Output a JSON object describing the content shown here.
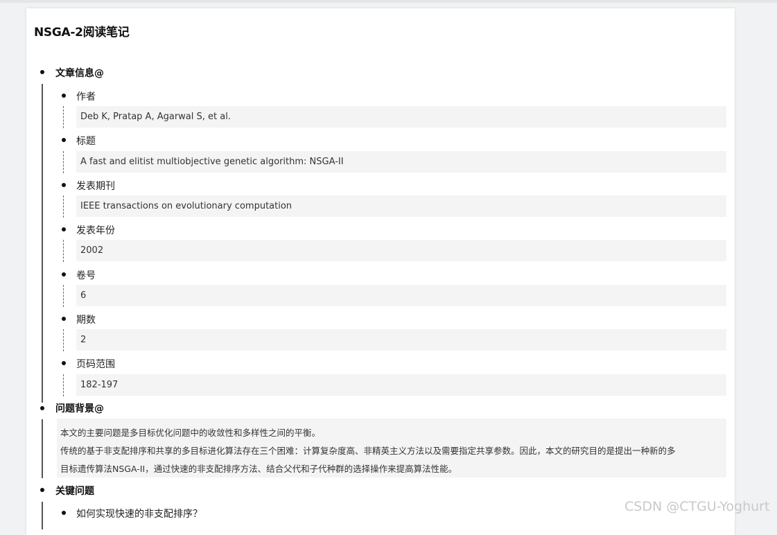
{
  "document": {
    "title": "NSGA-2阅读笔记",
    "sections": {
      "article_info": {
        "heading": "文章信息@",
        "fields": [
          {
            "label": "作者",
            "value": "Deb K, Pratap A, Agarwal S, et al."
          },
          {
            "label": "标题",
            "value": "A fast and elitist multiobjective genetic algorithm: NSGA-II"
          },
          {
            "label": "发表期刊",
            "value": "IEEE transactions on evolutionary computation"
          },
          {
            "label": "发表年份",
            "value": "2002"
          },
          {
            "label": "卷号",
            "value": "6"
          },
          {
            "label": "期数",
            "value": "2"
          },
          {
            "label": "页码范围",
            "value": "182-197"
          }
        ]
      },
      "background": {
        "heading": "问题背景@",
        "lines": [
          "本文的主要问题是多目标优化问题中的收敛性和多样性之间的平衡。",
          "传统的基于非支配排序和共享的多目标进化算法存在三个困难：计算复杂度高、非精英主义方法以及需要指定共享参数。因此，本文的研究目的是提出一种新的多",
          "目标遗传算法NSGA-II，通过快速的非支配排序方法、结合父代和子代种群的选择操作来提高算法性能。"
        ]
      },
      "key_questions": {
        "heading": "关键问题",
        "items": [
          "如何实现快速的非支配排序？"
        ]
      }
    }
  },
  "watermark": "CSDN @CTGU-Yoghurt"
}
